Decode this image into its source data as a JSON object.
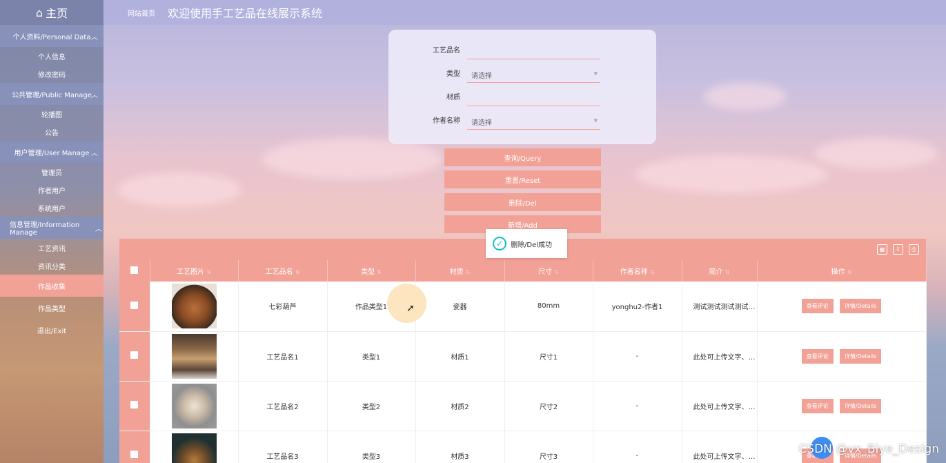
{
  "sidebar": {
    "home": "主页",
    "groups": [
      {
        "label": "个人资料/Personal Data",
        "items": [
          "个人信息",
          "修改密码"
        ]
      },
      {
        "label": "公共管理/Public Manage",
        "items": [
          "轮播图",
          "公告"
        ]
      },
      {
        "label": "用户管理/User Manage",
        "items": [
          "管理员",
          "作者用户",
          "系统用户"
        ]
      },
      {
        "label": "信息管理/Information Manage",
        "items": [
          "工艺资讯",
          "资讯分类",
          "作品收集",
          "作品类型",
          "退出/Exit"
        ]
      }
    ]
  },
  "topbar": {
    "crumb": "网站首页",
    "title": "欢迎使用手工艺品在线展示系统"
  },
  "search": {
    "name_label": "工艺品名",
    "type_label": "类型",
    "type_placeholder": "请选择",
    "material_label": "材质",
    "author_label": "作者名称",
    "author_placeholder": "请选择"
  },
  "buttons": {
    "query": "查询/Query",
    "reset": "重置/Reset",
    "delete": "删除/Del",
    "add": "新增/Add"
  },
  "toast": "删除/Del成功",
  "table": {
    "headers": [
      "工艺图片",
      "工艺品名",
      "类型",
      "材质",
      "尺寸",
      "作者名称",
      "简介",
      "操作"
    ],
    "rows": [
      {
        "name": "七彩葫芦",
        "type": "作品类型1",
        "material": "瓷器",
        "size": "80mm",
        "author": "yonghu2-作者1",
        "desc": "测试测试测试测试 测试"
      },
      {
        "name": "工艺品名1",
        "type": "类型1",
        "material": "材质1",
        "size": "尺寸1",
        "author": "-",
        "desc": "此处可上传文字、图片"
      },
      {
        "name": "工艺品名2",
        "type": "类型2",
        "material": "材质2",
        "size": "尺寸2",
        "author": "-",
        "desc": "此处可上传文字、图片"
      },
      {
        "name": "工艺品名3",
        "type": "类型3",
        "material": "材质3",
        "size": "尺寸3",
        "author": "-",
        "desc": "此处可上传文字、图片"
      }
    ],
    "op_comment": "查看评论",
    "op_details": "详情/Details"
  },
  "watermark": "CSDN @vx_Biye_Design",
  "colors": {
    "accent": "#f2a196",
    "sidebar_bg": "#8791b9",
    "toast_icon": "#13c2c2"
  }
}
